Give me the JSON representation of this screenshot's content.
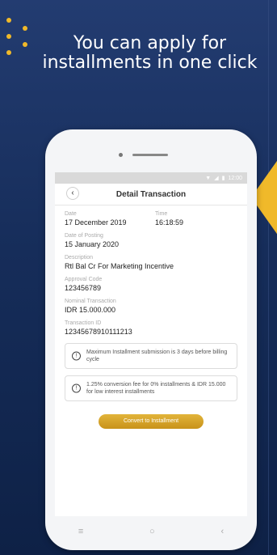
{
  "headline": {
    "line1": "You can apply for",
    "line2": "installments in one click"
  },
  "statusbar": {
    "wifi_icon": "wifi-icon",
    "signal_icon": "signal-icon",
    "battery_icon": "battery-icon",
    "time": "12:00"
  },
  "screen": {
    "back_symbol": "‹",
    "title": "Detail Transaction",
    "date_label": "Date",
    "date_value": "17 December 2019",
    "time_label": "Time",
    "time_value": "16:18:59",
    "posting_label": "Date of Posting",
    "posting_value": "15 January 2020",
    "description_label": "Description",
    "description_value": "Rtl Bal Cr For Marketing Incentive",
    "approval_label": "Approval Code",
    "approval_value": "123456789",
    "nominal_label": "Nominal Transaction",
    "nominal_value": "IDR 15.000.000",
    "txid_label": "Transaction ID",
    "txid_value": "12345678910111213",
    "info1": "Maximum Installment submission is 3 days before billing cycle",
    "info2": "1.25% conversion fee for 0% installments & IDR 15.000 for low interest installments",
    "info_symbol": "!",
    "cta_label": "Convert to Installment"
  },
  "navbar": {
    "menu_symbol": "≡",
    "home_symbol": "○",
    "back_symbol": "‹"
  },
  "colors": {
    "background": "#1b3466",
    "accent_yellow": "#f0b92a",
    "cta_gold": "#d4a22a"
  }
}
